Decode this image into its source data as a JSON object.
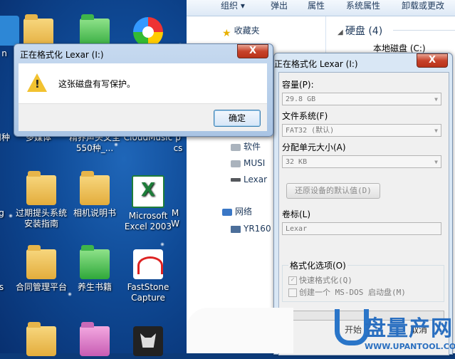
{
  "desktop": {
    "icons": [
      {
        "label": "",
        "kind": "folder"
      },
      {
        "label": "",
        "kind": "folder-green"
      },
      {
        "label": "",
        "kind": "pinwheel"
      },
      {
        "label": "用种",
        "kind": "partial"
      },
      {
        "label": "多媒体",
        "kind": "partial"
      },
      {
        "label": "精养声头文全 550种_...",
        "kind": "partial"
      },
      {
        "label": "CloudMusic",
        "kind": "partial"
      },
      {
        "label": "过期提头系统安装指南",
        "kind": "folder"
      },
      {
        "label": "相机说明书",
        "kind": "folder"
      },
      {
        "label": "Microsoft Excel 2003",
        "kind": "excel"
      },
      {
        "label": "合同管理平台",
        "kind": "folder"
      },
      {
        "label": "养生书籍",
        "kind": "folder-green"
      },
      {
        "label": "FastStone Capture",
        "kind": "faststone"
      },
      {
        "label": "",
        "kind": "folder"
      },
      {
        "label": "",
        "kind": "folder-pink"
      },
      {
        "label": "",
        "kind": "cat"
      }
    ],
    "edge_labels": {
      "n": "n",
      "g": "g",
      "s": "s",
      "m": "M",
      "w": "W",
      "pcs": "p\ncs"
    }
  },
  "explorer": {
    "toolbar": {
      "organize": "组织 ▾",
      "eject": "弹出",
      "properties": "属性",
      "system_properties": "系统属性",
      "uninstall": "卸载或更改"
    },
    "nav": {
      "favorites": "收藏夹",
      "software": "软件",
      "musi": "MUSI",
      "lexar": "Lexar",
      "network": "网络",
      "yr160": "YR160"
    },
    "content": {
      "heading": "硬盘 (4)",
      "local_disk": "本地磁盘 (C:)"
    }
  },
  "format_dialog": {
    "title": "正在格式化 Lexar (I:)",
    "close": "X",
    "capacity_label": "容量(P):",
    "capacity_value": "29.8 GB",
    "filesystem_label": "文件系统(F)",
    "filesystem_value": "FAT32 (默认)",
    "alloc_label": "分配单元大小(A)",
    "alloc_value": "32 KB",
    "restore_defaults": "还原设备的默认值(D)",
    "volume_label": "卷标(L)",
    "volume_value": "Lexar",
    "options_title": "格式化选项(O)",
    "quick_format": "快速格式化(Q)",
    "quick_format_checked": true,
    "msdos": "创建一个 MS-DOS 启动盘(M)",
    "msdos_checked": false,
    "start_button": "开始",
    "cancel_button": "取消"
  },
  "alert_dialog": {
    "title": "正在格式化 Lexar (I:)",
    "close": "X",
    "message": "这张磁盘有写保护。",
    "ok": "确定"
  },
  "watermark": {
    "brand": "盘量产网",
    "url": "WWW.UPANTOOL.COM"
  },
  "colors": {
    "desktop": "#0f4a96",
    "close_red": "#c7432b",
    "dialog_frame": "#d9e7f5",
    "watermark_blue": "#2a6fc0"
  }
}
